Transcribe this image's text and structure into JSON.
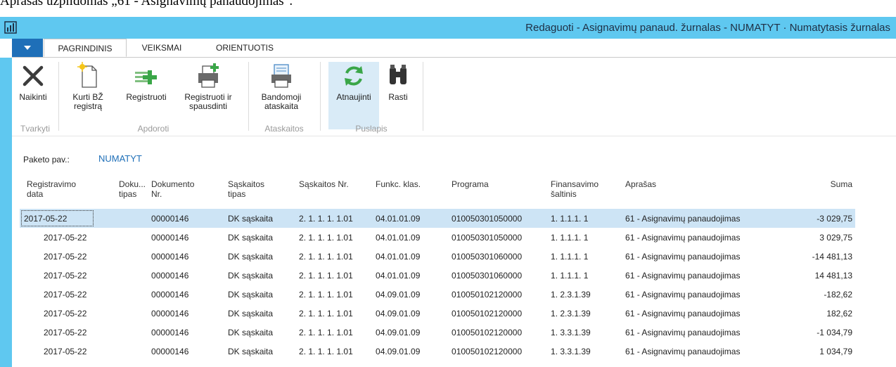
{
  "caption": "Aprašas užpildomas „61 - Asignavimų panaudojimas\".",
  "window": {
    "title": "Redaguoti - Asignavimų panaud. žurnalas - NUMATYT · Numatytasis žurnalas"
  },
  "tabs": [
    {
      "label": "PAGRINDINIS",
      "active": true
    },
    {
      "label": "VEIKSMAI",
      "active": false
    },
    {
      "label": "ORIENTUOTIS",
      "active": false
    }
  ],
  "ribbon": {
    "groups": [
      {
        "label": "Tvarkyti"
      },
      {
        "label": "Apdoroti"
      },
      {
        "label": "Ataskaitos"
      },
      {
        "label": "Puslapis"
      }
    ],
    "buttons": {
      "delete": {
        "line1": "Naikinti",
        "line2": "",
        "icon": "delete-x-icon"
      },
      "create_gl": {
        "line1": "Kurti BŽ",
        "line2": "registrą",
        "icon": "new-document-icon"
      },
      "post": {
        "line1": "Registruoti",
        "line2": "",
        "icon": "post-plus-icon"
      },
      "post_print": {
        "line1": "Registruoti ir",
        "line2": "spausdinti",
        "icon": "printer-plus-icon"
      },
      "test_report": {
        "line1": "Bandomoji",
        "line2": "ataskaita",
        "icon": "printer-report-icon"
      },
      "refresh": {
        "line1": "Atnaujinti",
        "line2": "",
        "icon": "refresh-icon"
      },
      "find": {
        "line1": "Rasti",
        "line2": "",
        "icon": "binoculars-icon"
      }
    }
  },
  "batch": {
    "label": "Paketo pav.:",
    "value": "NUMATYT"
  },
  "table": {
    "columns": [
      {
        "key": "date",
        "l1": "Registravimo",
        "l2": "data"
      },
      {
        "key": "doctype",
        "l1": "Doku...",
        "l2": "tipas"
      },
      {
        "key": "docno",
        "l1": "Dokumento",
        "l2": "Nr."
      },
      {
        "key": "acctype",
        "l1": "Sąskaitos",
        "l2": "tipas"
      },
      {
        "key": "accno",
        "l1": "Sąskaitos Nr.",
        "l2": ""
      },
      {
        "key": "func",
        "l1": "Funkc. klas.",
        "l2": ""
      },
      {
        "key": "program",
        "l1": "Programa",
        "l2": ""
      },
      {
        "key": "source",
        "l1": "Finansavimo",
        "l2": "šaltinis"
      },
      {
        "key": "desc",
        "l1": "Aprašas",
        "l2": ""
      },
      {
        "key": "amount",
        "l1": "Suma",
        "l2": ""
      }
    ],
    "rows": [
      {
        "date": "2017-05-22",
        "doctype": "",
        "docno": "00000146",
        "acctype": "DK sąskaita",
        "accno": "2. 1. 1. 1. 1.01",
        "func": "04.01.01.09",
        "program": "010050301050000",
        "source": "1. 1.1.1. 1",
        "desc": "61 - Asignavimų panaudojimas",
        "amount": "-3 029,75"
      },
      {
        "date": "2017-05-22",
        "doctype": "",
        "docno": "00000146",
        "acctype": "DK sąskaita",
        "accno": "2. 1. 1. 1. 1.01",
        "func": "04.01.01.09",
        "program": "010050301050000",
        "source": "1. 1.1.1. 1",
        "desc": "61 - Asignavimų panaudojimas",
        "amount": "3 029,75"
      },
      {
        "date": "2017-05-22",
        "doctype": "",
        "docno": "00000146",
        "acctype": "DK sąskaita",
        "accno": "2. 1. 1. 1. 1.01",
        "func": "04.01.01.09",
        "program": "010050301060000",
        "source": "1. 1.1.1. 1",
        "desc": "61 - Asignavimų panaudojimas",
        "amount": "-14 481,13"
      },
      {
        "date": "2017-05-22",
        "doctype": "",
        "docno": "00000146",
        "acctype": "DK sąskaita",
        "accno": "2. 1. 1. 1. 1.01",
        "func": "04.01.01.09",
        "program": "010050301060000",
        "source": "1. 1.1.1. 1",
        "desc": "61 - Asignavimų panaudojimas",
        "amount": "14 481,13"
      },
      {
        "date": "2017-05-22",
        "doctype": "",
        "docno": "00000146",
        "acctype": "DK sąskaita",
        "accno": "2. 1. 1. 1. 1.01",
        "func": "04.09.01.09",
        "program": "010050102120000",
        "source": "1. 2.3.1.39",
        "desc": "61 - Asignavimų panaudojimas",
        "amount": "-182,62"
      },
      {
        "date": "2017-05-22",
        "doctype": "",
        "docno": "00000146",
        "acctype": "DK sąskaita",
        "accno": "2. 1. 1. 1. 1.01",
        "func": "04.09.01.09",
        "program": "010050102120000",
        "source": "1. 2.3.1.39",
        "desc": "61 - Asignavimų panaudojimas",
        "amount": "182,62"
      },
      {
        "date": "2017-05-22",
        "doctype": "",
        "docno": "00000146",
        "acctype": "DK sąskaita",
        "accno": "2. 1. 1. 1. 1.01",
        "func": "04.09.01.09",
        "program": "010050102120000",
        "source": "1. 3.3.1.39",
        "desc": "61 - Asignavimų panaudojimas",
        "amount": "-1 034,79"
      },
      {
        "date": "2017-05-22",
        "doctype": "",
        "docno": "00000146",
        "acctype": "DK sąskaita",
        "accno": "2. 1. 1. 1. 1.01",
        "func": "04.09.01.09",
        "program": "010050102120000",
        "source": "1. 3.3.1.39",
        "desc": "61 - Asignavimų panaudojimas",
        "amount": "1 034,79"
      }
    ]
  },
  "colors": {
    "titlebar": "#5fc8f0",
    "accent": "#1e6fb8",
    "selected_row": "#cde4f5"
  }
}
